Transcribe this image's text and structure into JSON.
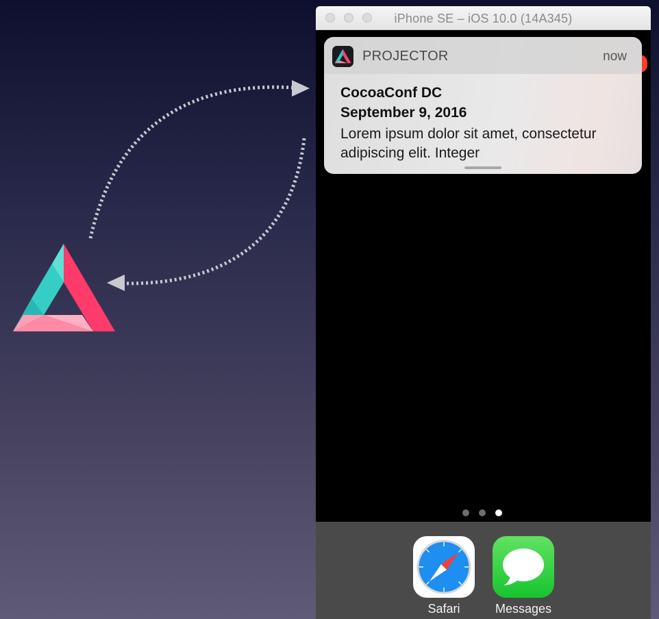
{
  "simulator": {
    "window_title": "iPhone SE – iOS 10.0 (14A345)"
  },
  "notification": {
    "app_name": "PROJECTOR",
    "time": "now",
    "title": "CocoaConf DC",
    "subtitle": "September 9, 2016",
    "body": "Lorem ipsum dolor sit amet, consectetur adipiscing elit. Integer"
  },
  "home_screen": {
    "page_count": 3,
    "current_page": 3
  },
  "dock": {
    "apps": [
      {
        "label": "Safari",
        "icon": "safari-icon"
      },
      {
        "label": "Messages",
        "icon": "messages-icon"
      }
    ]
  },
  "colors": {
    "brand_pink": "#ff3b6b",
    "brand_teal": "#3cd6cf",
    "brand_light_pink": "#ff9db3",
    "arrow": "#c9c9d2"
  }
}
